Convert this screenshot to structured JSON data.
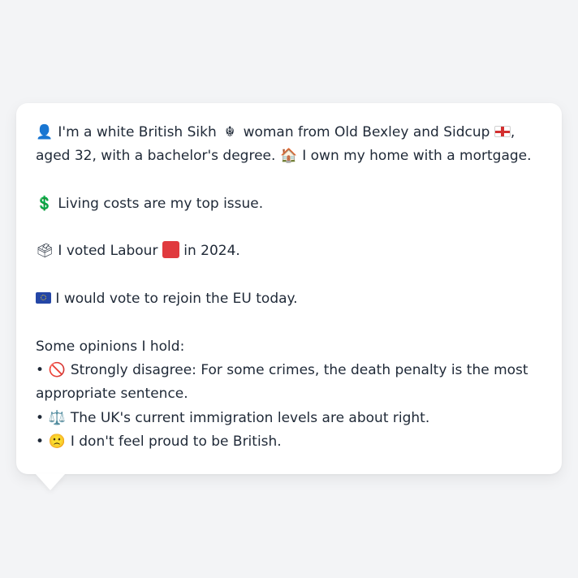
{
  "persona": {
    "intro": {
      "icon_person": "👤",
      "text_a": "I'm a white British Sikh",
      "icon_khanda": "☬",
      "text_b": "woman from Old Bexley and Sidcup",
      "flag_england": "england-flag",
      "text_c": ", aged 32, with a bachelor's degree.",
      "icon_house": "🏠",
      "text_d": "I own my home with a mortgage."
    },
    "issue": {
      "icon": "💲",
      "text": "Living costs are my top issue."
    },
    "vote": {
      "icon": "🗳",
      "text_a": "I voted Labour",
      "party_color": "#e03a3e",
      "text_b": "in 2024."
    },
    "eu": {
      "icon": "eu-flag",
      "text": "I would vote to rejoin the EU today."
    },
    "opinions": {
      "heading": "Some opinions I hold:",
      "items": [
        {
          "bullet": "•",
          "icon": "🚫",
          "text": "Strongly disagree: For some crimes, the death penalty is the most appropriate sentence."
        },
        {
          "bullet": "•",
          "icon": "⚖️",
          "text": "The UK's current immigration levels are about right."
        },
        {
          "bullet": "•",
          "icon": "🙁",
          "text": "I don't feel proud to be British."
        }
      ]
    }
  }
}
